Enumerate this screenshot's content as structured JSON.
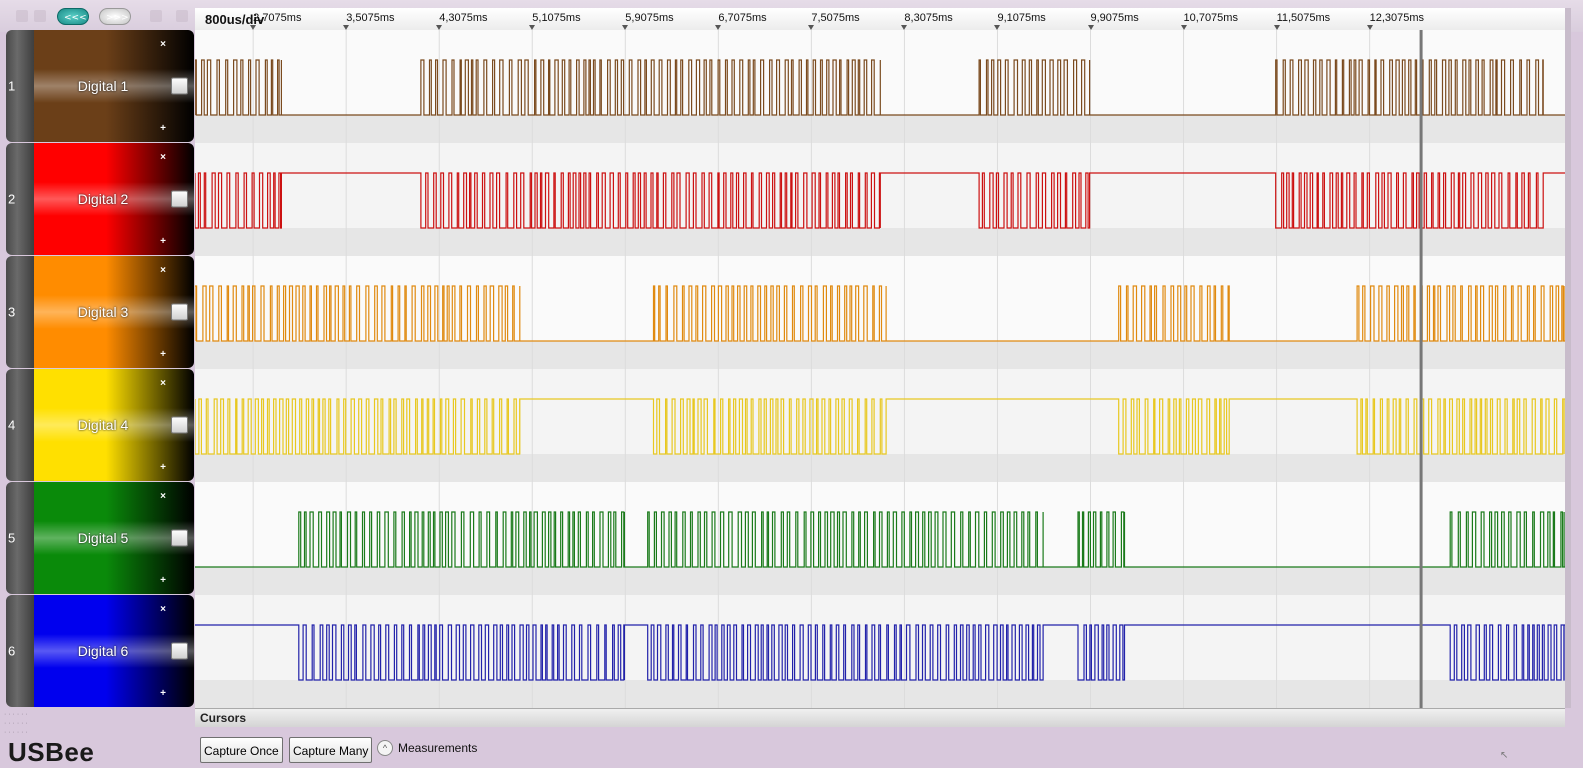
{
  "nav": {
    "back_label": "<<<",
    "forward_label": ">>>"
  },
  "timebase": {
    "div_label": "800us/div",
    "ticks": [
      "2,7075ms",
      "3,5075ms",
      "4,3075ms",
      "5,1075ms",
      "5,9075ms",
      "6,7075ms",
      "7,5075ms",
      "8,3075ms",
      "9,1075ms",
      "9,9075ms",
      "10,7075ms",
      "11,5075ms",
      "12,3075ms"
    ]
  },
  "channels": [
    {
      "number": "1",
      "name": "Digital 1",
      "color": "#7a4a1e",
      "head_color": "#6b3f18",
      "checked": false
    },
    {
      "number": "2",
      "name": "Digital 2",
      "color": "#cc1111",
      "head_color": "#ff0000",
      "checked": false
    },
    {
      "number": "3",
      "name": "Digital 3",
      "color": "#e08a10",
      "head_color": "#ff8c00",
      "checked": false
    },
    {
      "number": "4",
      "name": "Digital 4",
      "color": "#e8c820",
      "head_color": "#ffe000",
      "checked": false
    },
    {
      "number": "5",
      "name": "Digital 5",
      "color": "#1a7a1a",
      "head_color": "#0a8a0a",
      "checked": false
    },
    {
      "number": "6",
      "name": "Digital 6",
      "color": "#2222aa",
      "head_color": "#0000ee",
      "checked": false
    }
  ],
  "channel_controls": {
    "remove_glyph": "×",
    "add_glyph": "+"
  },
  "cursors": {
    "label": "Cursors",
    "cursor_time_ms": 12.75
  },
  "toolbar": {
    "capture_once_label": "Capture Once",
    "capture_many_label": "Capture Many",
    "measurements_toggle_glyph": "^",
    "measurements_label": "Measurements"
  },
  "app": {
    "logo_text": "USBee"
  },
  "waveform": {
    "view_start_ms": 2.2075,
    "view_end_ms": 13.9875,
    "bursts": [
      [
        [
          2.2075,
          2.95
        ],
        [
          4.15,
          8.1
        ],
        [
          8.95,
          9.9
        ],
        [
          11.5,
          13.8
        ]
      ],
      [
        [
          2.2075,
          2.95
        ],
        [
          4.15,
          8.1
        ],
        [
          8.95,
          9.9
        ],
        [
          11.5,
          13.8
        ]
      ],
      [
        [
          2.2075,
          5.0
        ],
        [
          6.15,
          8.15
        ],
        [
          10.15,
          11.1
        ],
        [
          12.2,
          13.98
        ]
      ],
      [
        [
          2.2075,
          5.0
        ],
        [
          6.15,
          8.15
        ],
        [
          10.15,
          11.1
        ],
        [
          12.2,
          13.98
        ]
      ],
      [
        [
          3.1,
          5.9
        ],
        [
          6.1,
          9.5
        ],
        [
          9.8,
          10.2
        ],
        [
          13.0,
          13.98
        ]
      ],
      [
        [
          3.1,
          5.9
        ],
        [
          6.1,
          9.5
        ],
        [
          9.8,
          10.2
        ],
        [
          13.0,
          13.98
        ]
      ]
    ],
    "idle_high": [
      false,
      true,
      false,
      true,
      false,
      true
    ]
  }
}
